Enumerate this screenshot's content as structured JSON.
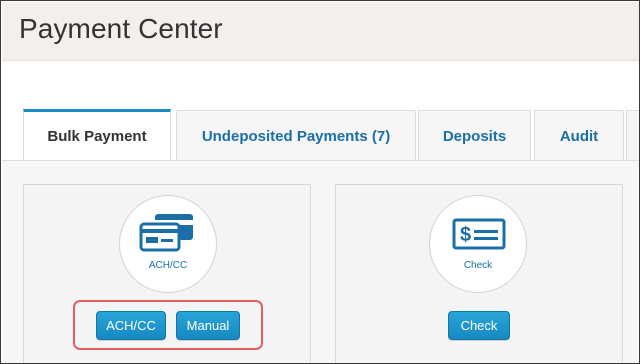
{
  "header": {
    "title": "Payment Center"
  },
  "tabs": [
    {
      "label": "Bulk Payment",
      "active": true
    },
    {
      "label": "Undeposited Payments (7)",
      "active": false
    },
    {
      "label": "Deposits",
      "active": false
    },
    {
      "label": "Audit",
      "active": false
    }
  ],
  "cards": {
    "achcc": {
      "icon_label": "ACH/CC",
      "buttons": {
        "achcc": "ACH/CC",
        "manual": "Manual"
      }
    },
    "check": {
      "icon_label": "Check",
      "buttons": {
        "check": "Check"
      }
    }
  },
  "colors": {
    "accent": "#1a6fa8",
    "button": "#1b95cc",
    "highlight": "#e06060"
  }
}
